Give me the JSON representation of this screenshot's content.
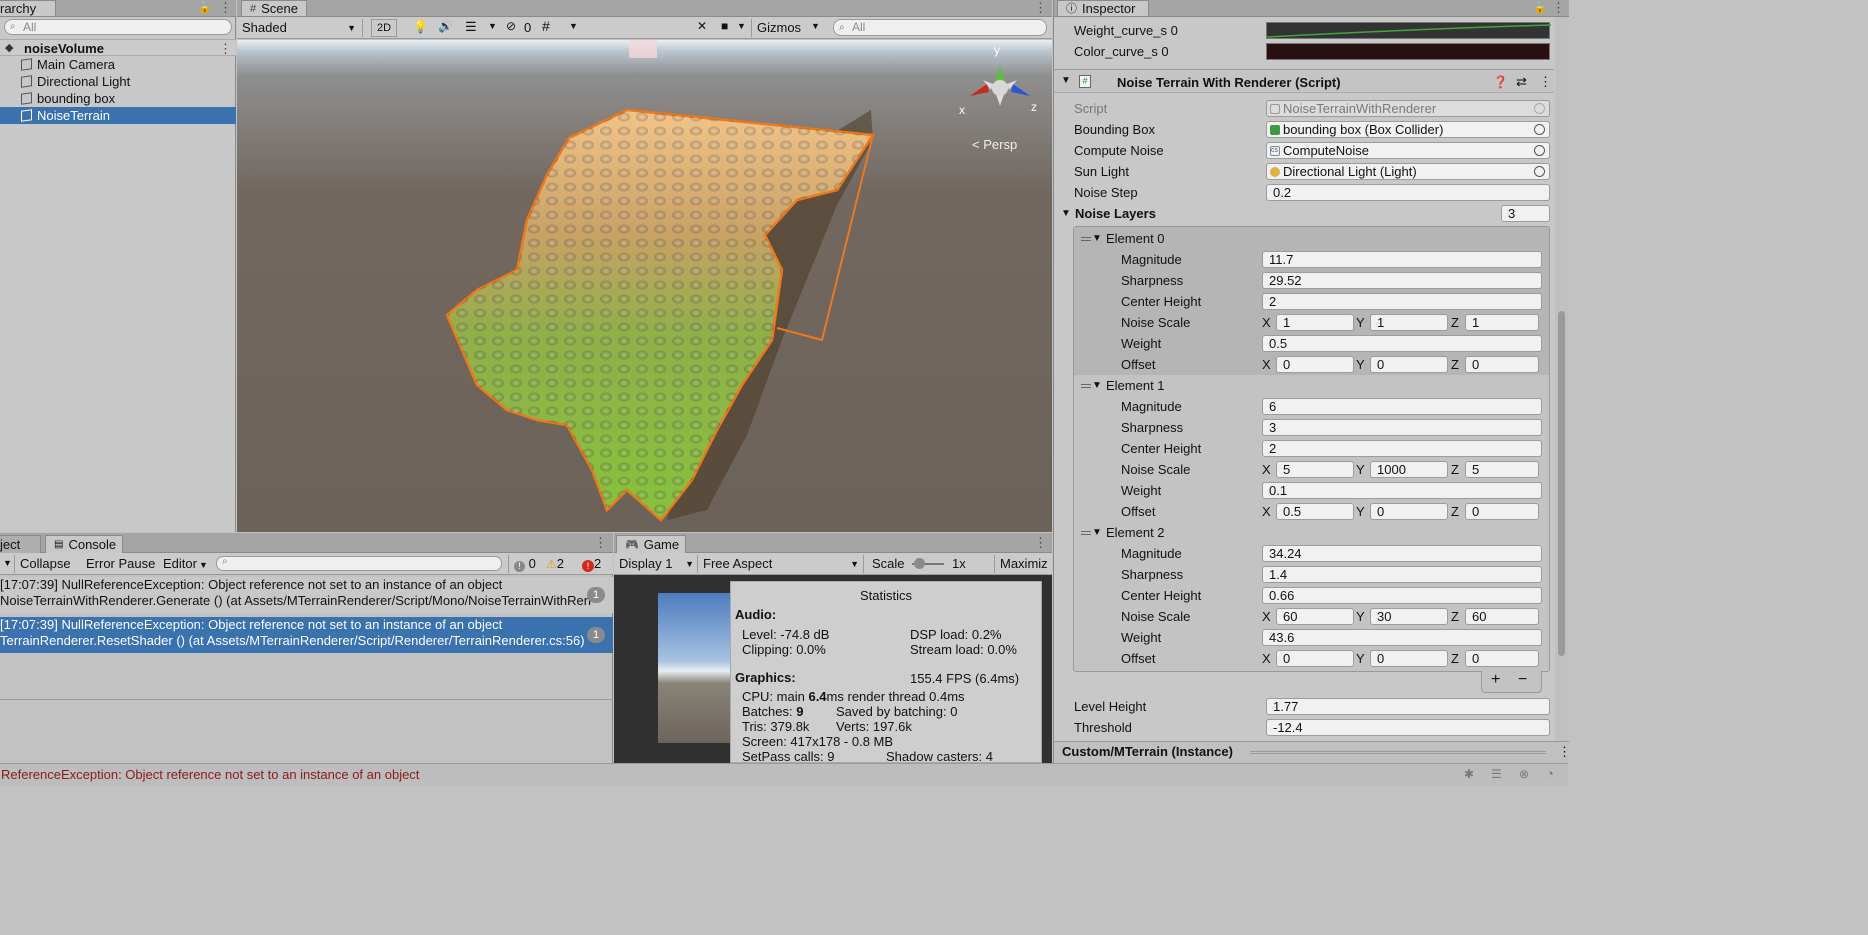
{
  "hierarchy": {
    "tab_label": "rarchy",
    "search_placeholder": "All",
    "scene_name": "noiseVolume",
    "items": [
      "Main Camera",
      "Directional Light",
      "bounding box",
      "NoiseTerrain"
    ],
    "selected": "NoiseTerrain"
  },
  "scene": {
    "tab_label": "Scene",
    "shading_mode": "Shaded",
    "toggle_2d": "2D",
    "hidden_count": "0",
    "gizmos_label": "Gizmos",
    "search_placeholder": "All",
    "persp_label": "Persp",
    "axis_labels": {
      "x": "x",
      "y": "y",
      "z": "z"
    }
  },
  "console": {
    "tab_project": "ject",
    "tab_console": "Console",
    "collapse": "Collapse",
    "error_pause": "Error Pause",
    "editor": "Editor",
    "info_count": "0",
    "warning_count": "2",
    "error_count": "2",
    "entries": [
      {
        "line1": "[17:07:39] NullReferenceException: Object reference not set to an instance of an object",
        "line2": "NoiseTerrainWithRenderer.Generate () (at Assets/MTerrainRenderer/Script/Mono/NoiseTerrainWithRen",
        "count": "1",
        "selected": false
      },
      {
        "line1": "[17:07:39] NullReferenceException: Object reference not set to an instance of an object",
        "line2": "TerrainRenderer.ResetShader () (at Assets/MTerrainRenderer/Script/Renderer/TerrainRenderer.cs:56)",
        "count": "1",
        "selected": true
      }
    ]
  },
  "game": {
    "tab_label": "Game",
    "display": "Display 1",
    "aspect": "Free Aspect",
    "scale_label": "Scale",
    "scale_value": "1x",
    "maximize": "Maximiz",
    "stats": {
      "title": "Statistics",
      "audio_heading": "Audio:",
      "level": "Level: -74.8 dB",
      "clipping": "Clipping: 0.0%",
      "dsp": "DSP load: 0.2%",
      "stream": "Stream load: 0.0%",
      "graphics_heading": "Graphics:",
      "fps": "155.4 FPS (6.4ms)",
      "cpu_prefix": "CPU: main ",
      "cpu_main": "6.4",
      "cpu_suffix": "ms  render thread 0.4ms",
      "batches_prefix": "Batches: ",
      "batches": "9",
      "saved": "Saved by batching: 0",
      "tris": "Tris: 379.8k",
      "verts": "Verts: 197.6k",
      "screen": "Screen: 417x178 - 0.8 MB",
      "setpass": "SetPass calls: 9",
      "shadow": "Shadow casters: 4"
    }
  },
  "inspector": {
    "tab_label": "Inspector",
    "curves": [
      {
        "label": "Weight_curve_s 0"
      },
      {
        "label": "Color_curve_s 0"
      }
    ],
    "component_title": "Noise Terrain With Renderer (Script)",
    "fields": {
      "script": {
        "label": "Script",
        "value": "NoiseTerrainWithRenderer"
      },
      "bounding_box": {
        "label": "Bounding Box",
        "value": "bounding box (Box Collider)"
      },
      "compute_noise": {
        "label": "Compute Noise",
        "value": "ComputeNoise"
      },
      "sun_light": {
        "label": "Sun Light",
        "value": "Directional Light (Light)"
      },
      "noise_step": {
        "label": "Noise Step",
        "value": "0.2"
      }
    },
    "noise_layers": {
      "label": "Noise Layers",
      "size": "3"
    },
    "element_labels": {
      "magnitude": "Magnitude",
      "sharpness": "Sharpness",
      "center_height": "Center Height",
      "noise_scale": "Noise Scale",
      "weight": "Weight",
      "offset": "Offset"
    },
    "elements": [
      {
        "title": "Element 0",
        "magnitude": "11.7",
        "sharpness": "29.52",
        "center_height": "2",
        "noise_scale": [
          "1",
          "1",
          "1"
        ],
        "weight": "0.5",
        "offset": [
          "0",
          "0",
          "0"
        ]
      },
      {
        "title": "Element 1",
        "magnitude": "6",
        "sharpness": "3",
        "center_height": "2",
        "noise_scale": [
          "5",
          "1000",
          "5"
        ],
        "weight": "0.1",
        "offset": [
          "0.5",
          "0",
          "0"
        ]
      },
      {
        "title": "Element 2",
        "magnitude": "34.24",
        "sharpness": "1.4",
        "center_height": "0.66",
        "noise_scale": [
          "60",
          "30",
          "60"
        ],
        "weight": "43.6",
        "offset": [
          "0",
          "0",
          "0"
        ]
      }
    ],
    "xyz": [
      "X",
      "Y",
      "Z"
    ],
    "plus": "+",
    "minus": "−",
    "level_height": {
      "label": "Level Height",
      "value": "1.77"
    },
    "threshold": {
      "label": "Threshold",
      "value": "-12.4"
    },
    "material": "Custom/MTerrain (Instance)"
  },
  "status_bar": {
    "message": "ReferenceException: Object reference not set to an instance of an object"
  },
  "colors": {
    "selection": "#3a72b0",
    "selection_outline": "#f07818",
    "error_red": "#8b1a1a"
  }
}
